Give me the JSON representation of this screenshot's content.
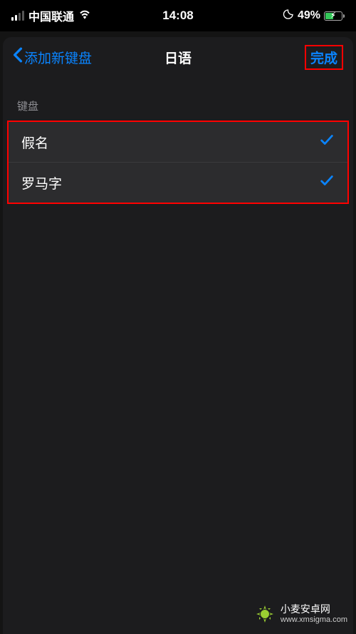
{
  "status_bar": {
    "carrier": "中国联通",
    "time": "14:08",
    "battery_percent": "49%"
  },
  "nav": {
    "back_label": "添加新键盘",
    "title": "日语",
    "done_label": "完成"
  },
  "section": {
    "header": "键盘"
  },
  "keyboard_options": [
    {
      "label": "假名",
      "selected": true
    },
    {
      "label": "罗马字",
      "selected": true
    }
  ],
  "watermark": {
    "title": "小麦安卓网",
    "url": "www.xmsigma.com"
  }
}
